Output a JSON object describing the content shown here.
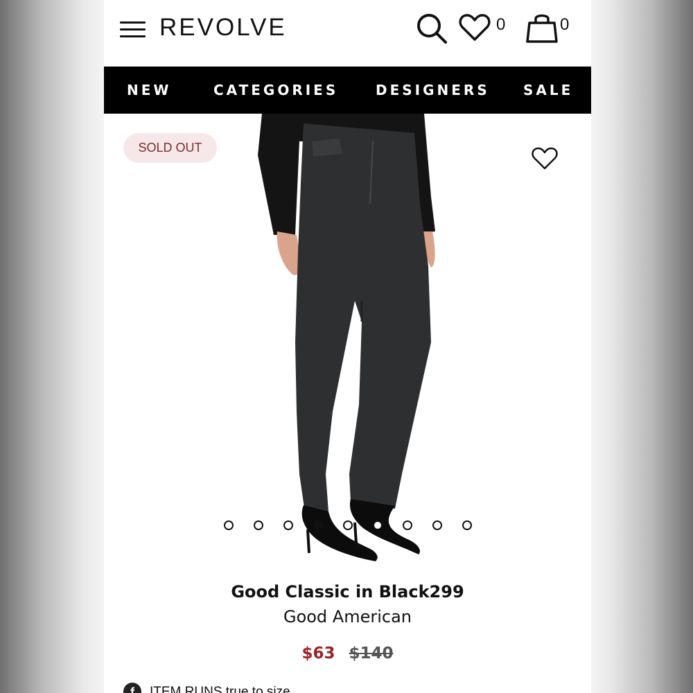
{
  "header": {
    "logo": "REVOLVE",
    "wishlist_count": "0",
    "bag_count": "0"
  },
  "nav": {
    "items": [
      "NEW",
      "CATEGORIES",
      "DESIGNERS",
      "SALE"
    ]
  },
  "product": {
    "badge": "SOLD OUT",
    "title": "Good Classic in Black299",
    "brand": "Good American",
    "sale_price": "$63",
    "original_price": "$140",
    "fit_label": "ITEM RUNS",
    "fit_value": "true to size",
    "image_count": 9,
    "active_image_index": 3
  },
  "colors": {
    "nav_bg": "#000000",
    "sale_price": "#9b2226",
    "badge_bg": "#f6e8e8",
    "badge_text": "#7a2c2c"
  }
}
